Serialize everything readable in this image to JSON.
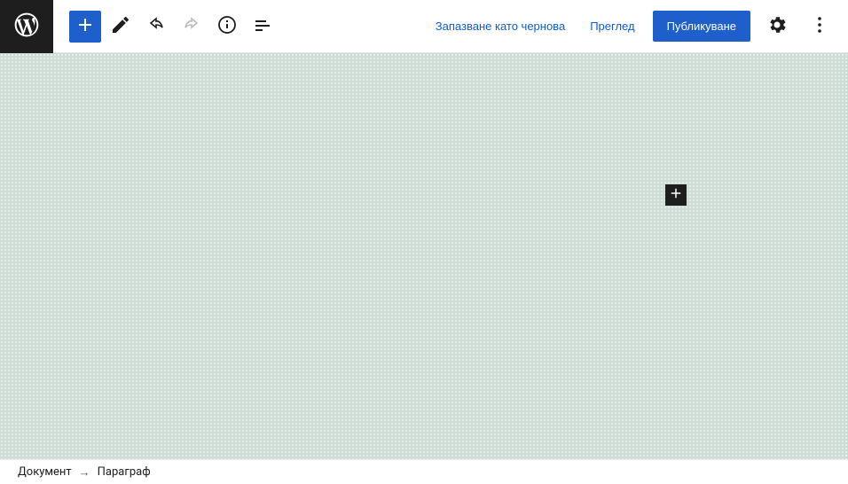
{
  "toolbar": {
    "save_draft": "Запазване като чернова",
    "preview": "Преглед",
    "publish": "Публикуване"
  },
  "breadcrumb": {
    "root": "Документ",
    "current": "Параграф"
  }
}
